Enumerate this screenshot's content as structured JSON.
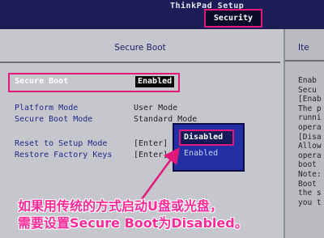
{
  "header": {
    "app_title": "ThinkPad Setup",
    "active_tab": "Security"
  },
  "panel": {
    "title": "Secure Boot",
    "side_title": "Ite"
  },
  "settings": {
    "secure_boot": {
      "label": "Secure Boot",
      "value": "Enabled"
    },
    "platform_mode": {
      "label": "Platform Mode",
      "value": "User Mode"
    },
    "secure_boot_mode": {
      "label": "Secure Boot Mode",
      "value": "Standard Mode"
    },
    "reset_setup": {
      "label": "Reset to Setup Mode",
      "value": "[Enter]"
    },
    "restore_keys": {
      "label": "Restore Factory Keys",
      "value": "[Enter]"
    }
  },
  "popup": {
    "options": [
      "Disabled",
      "Enabled"
    ],
    "selected": "Disabled"
  },
  "help_lines": [
    "Enab",
    "Secu",
    "[Enab",
    "The p",
    "runni",
    "opera",
    "[Disa",
    "Allow",
    "opera",
    "boot",
    "Note:",
    "Boot",
    "the s",
    "you t"
  ],
  "overlay": {
    "line1": "如果用传统的方式启动U盘或光盘，",
    "line2": "需要设置Secure Boot为Disabled。"
  },
  "colors": {
    "highlight": "#e0197a",
    "overlay_text": "#ff2a9a",
    "topbar": "#1c1d56"
  }
}
